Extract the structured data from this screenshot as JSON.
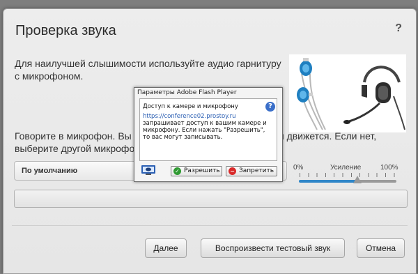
{
  "dialog": {
    "title": "Проверка звука",
    "help": "?",
    "description": "Для наилучшей слышимости используйте аудио гарнитуру с микрофоном.",
    "prompt": "Говорите в микрофон. Вы видите, что индикатор громкости движется. Если нет, выберите другой микрофон.",
    "mic_select": {
      "value": "По умолчанию"
    },
    "gain": {
      "min": "0%",
      "label": "Усиление",
      "max": "100%",
      "level": 0.6
    },
    "buttons": {
      "next": "Далее",
      "test": "Воспроизвести тестовый звук",
      "cancel": "Отмена"
    }
  },
  "flash": {
    "title": "Параметры Adobe Flash Player",
    "heading": "Доступ к камере и микрофону",
    "url": "https://conference02.prostoy.ru",
    "text": "запрашивает доступ к вашим камере и микрофону. Если нажать \"Разрешить\", то вас могут записывать.",
    "allow": "Разрешить",
    "deny": "Запретить",
    "allow_icon": "check-icon",
    "deny_icon": "minus-icon"
  },
  "colors": {
    "accent": "#2f86c8",
    "link": "#2b5fb3",
    "allow": "#2f9a32",
    "deny": "#d92a2a"
  }
}
